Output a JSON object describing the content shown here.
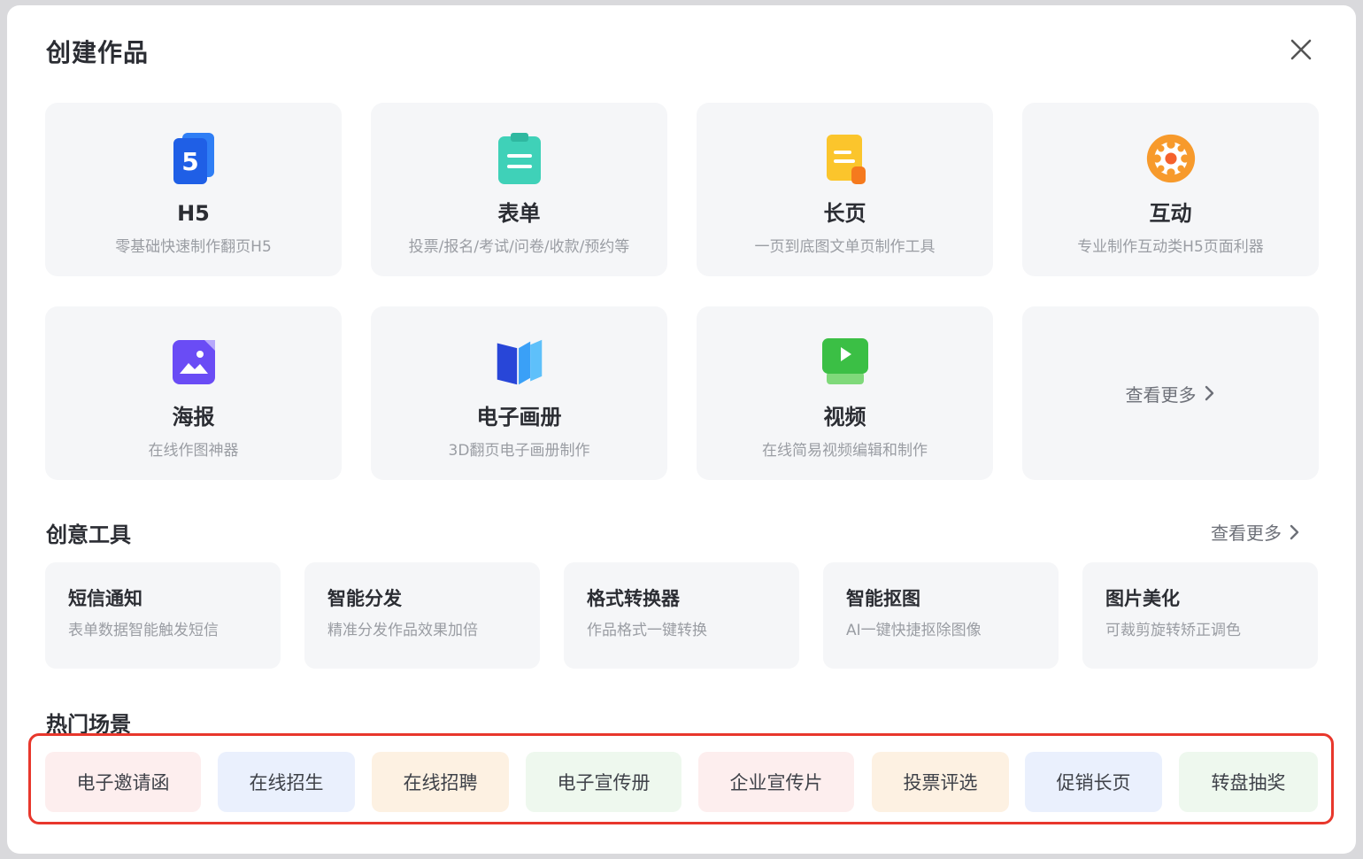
{
  "modal": {
    "title": "创建作品"
  },
  "products": [
    {
      "name": "H5",
      "desc": "零基础快速制作翻页H5",
      "icon": "h5-icon"
    },
    {
      "name": "表单",
      "desc": "投票/报名/考试/问卷/收款/预约等",
      "icon": "form-icon"
    },
    {
      "name": "长页",
      "desc": "一页到底图文单页制作工具",
      "icon": "long-page-icon"
    },
    {
      "name": "互动",
      "desc": "专业制作互动类H5页面利器",
      "icon": "interactive-icon"
    },
    {
      "name": "海报",
      "desc": "在线作图神器",
      "icon": "poster-icon"
    },
    {
      "name": "电子画册",
      "desc": "3D翻页电子画册制作",
      "icon": "ebook-icon"
    },
    {
      "name": "视频",
      "desc": "在线简易视频编辑和制作",
      "icon": "video-icon"
    }
  ],
  "products_more": "查看更多",
  "tools_section": {
    "title": "创意工具",
    "more": "查看更多",
    "items": [
      {
        "name": "短信通知",
        "desc": "表单数据智能触发短信"
      },
      {
        "name": "智能分发",
        "desc": "精准分发作品效果加倍"
      },
      {
        "name": "格式转换器",
        "desc": "作品格式一键转换"
      },
      {
        "name": "智能抠图",
        "desc": "AI一键快捷抠除图像"
      },
      {
        "name": "图片美化",
        "desc": "可裁剪旋转矫正调色"
      }
    ]
  },
  "hot_section": {
    "title": "热门场景",
    "highlight_color": "#e8372c",
    "items": [
      {
        "label": "电子邀请函",
        "bg": "#fdeeee"
      },
      {
        "label": "在线招生",
        "bg": "#eaf0fd"
      },
      {
        "label": "在线招聘",
        "bg": "#fdf1e2"
      },
      {
        "label": "电子宣传册",
        "bg": "#eef8ee"
      },
      {
        "label": "企业宣传片",
        "bg": "#fdeeee"
      },
      {
        "label": "投票评选",
        "bg": "#fdf1e2"
      },
      {
        "label": "促销长页",
        "bg": "#eaf0fd"
      },
      {
        "label": "转盘抽奖",
        "bg": "#eef8ee"
      }
    ]
  }
}
